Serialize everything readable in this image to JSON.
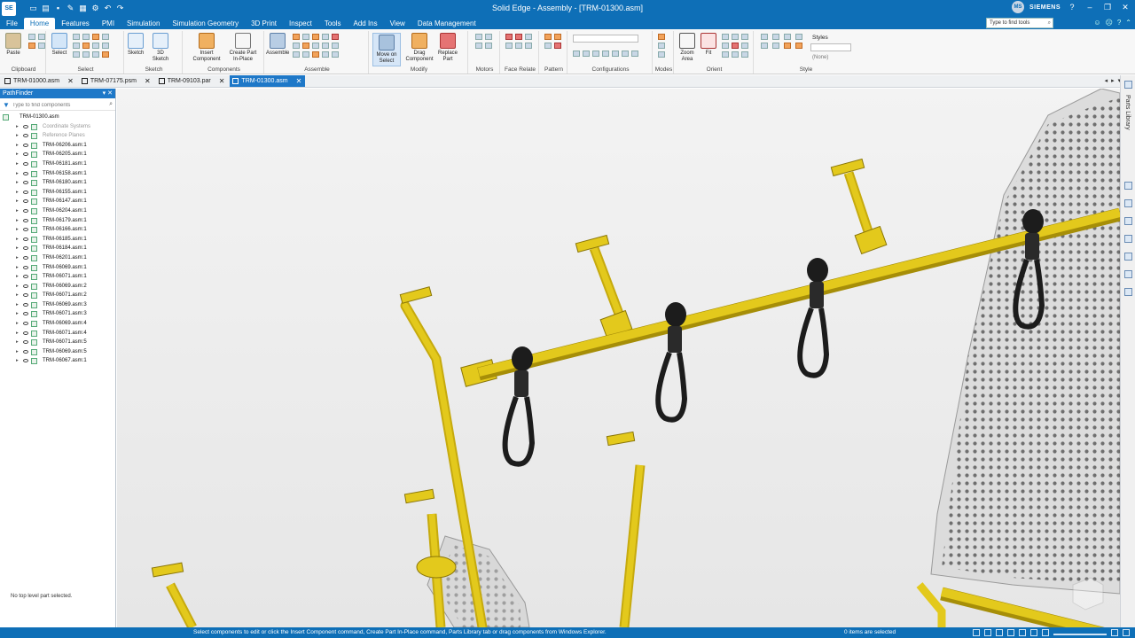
{
  "app": {
    "logo": "SE",
    "title": "Solid Edge - Assembly - [TRM-01300.asm]",
    "user_initials": "MS",
    "brand": "SIEMENS",
    "window_buttons": [
      "?",
      "–",
      "❐",
      "✕"
    ]
  },
  "menu": {
    "items": [
      "File",
      "Home",
      "Features",
      "PMI",
      "Simulation",
      "Simulation Geometry",
      "3D Print",
      "Inspect",
      "Tools",
      "Add Ins",
      "View",
      "Data Management"
    ],
    "active": "Home",
    "find_placeholder": "Type to find tools"
  },
  "ribbon": {
    "groups": [
      "Clipboard",
      "Select",
      "Sketch",
      "Components",
      "Assemble",
      "Modify",
      "Motors",
      "Face Relate",
      "Pattern",
      "Configurations",
      "Modes",
      "Orient",
      "Style"
    ],
    "buttons": {
      "paste": "Paste",
      "select": "Select",
      "sketch": "Sketch",
      "sketch3d": "3D Sketch",
      "insert_component": "Insert Component",
      "create_part": "Create Part In-Place",
      "assemble": "Assemble",
      "move_on_select": "Move on Select",
      "drag_component": "Drag Component",
      "replace_part": "Replace Part",
      "zoom_area": "Zoom Area",
      "fit": "Fit"
    },
    "style_label": "Styles",
    "style_value": "(None)"
  },
  "doc_tabs": [
    {
      "label": "TRM-01000.asm",
      "active": false
    },
    {
      "label": "TRM-07175.psm",
      "active": false
    },
    {
      "label": "TRM-09103.par",
      "active": false
    },
    {
      "label": "TRM-01300.asm",
      "active": true
    }
  ],
  "pathfinder": {
    "title": "PathFinder",
    "filter_placeholder": "Type to find components",
    "root": "TRM-01300.asm",
    "system_items": [
      "Coordinate Systems",
      "Reference Planes"
    ],
    "items": [
      "TRM-06206.asm:1",
      "TRM-06205.asm:1",
      "TRM-06181.asm:1",
      "TRM-06158.asm:1",
      "TRM-06180.asm:1",
      "TRM-06155.asm:1",
      "TRM-06147.asm:1",
      "TRM-06204.asm:1",
      "TRM-06179.asm:1",
      "TRM-06166.asm:1",
      "TRM-06185.asm:1",
      "TRM-06184.asm:1",
      "TRM-06201.asm:1",
      "TRM-06069.asm:1",
      "TRM-06071.asm:1",
      "TRM-06069.asm:2",
      "TRM-06071.asm:2",
      "TRM-06069.asm:3",
      "TRM-06071.asm:3",
      "TRM-06069.asm:4",
      "TRM-06071.asm:4",
      "TRM-06071.asm:5",
      "TRM-06069.asm:5",
      "TRM-06067.asm:1"
    ],
    "status": "No top level part selected."
  },
  "rail": {
    "parts_library": "Parts Library"
  },
  "status_bar": {
    "message": "Select components to edit or click the Insert Component command, Create Part In-Place command, Parts Library tab or drag components from Windows Explorer.",
    "selection": "0 items are selected"
  },
  "colors": {
    "accent": "#0e6fb7",
    "tab_active": "#1e78c8",
    "rail_yellow": "#e3c91c",
    "strap_black": "#1c1c1c",
    "panel_grey": "#d4d4d4"
  }
}
